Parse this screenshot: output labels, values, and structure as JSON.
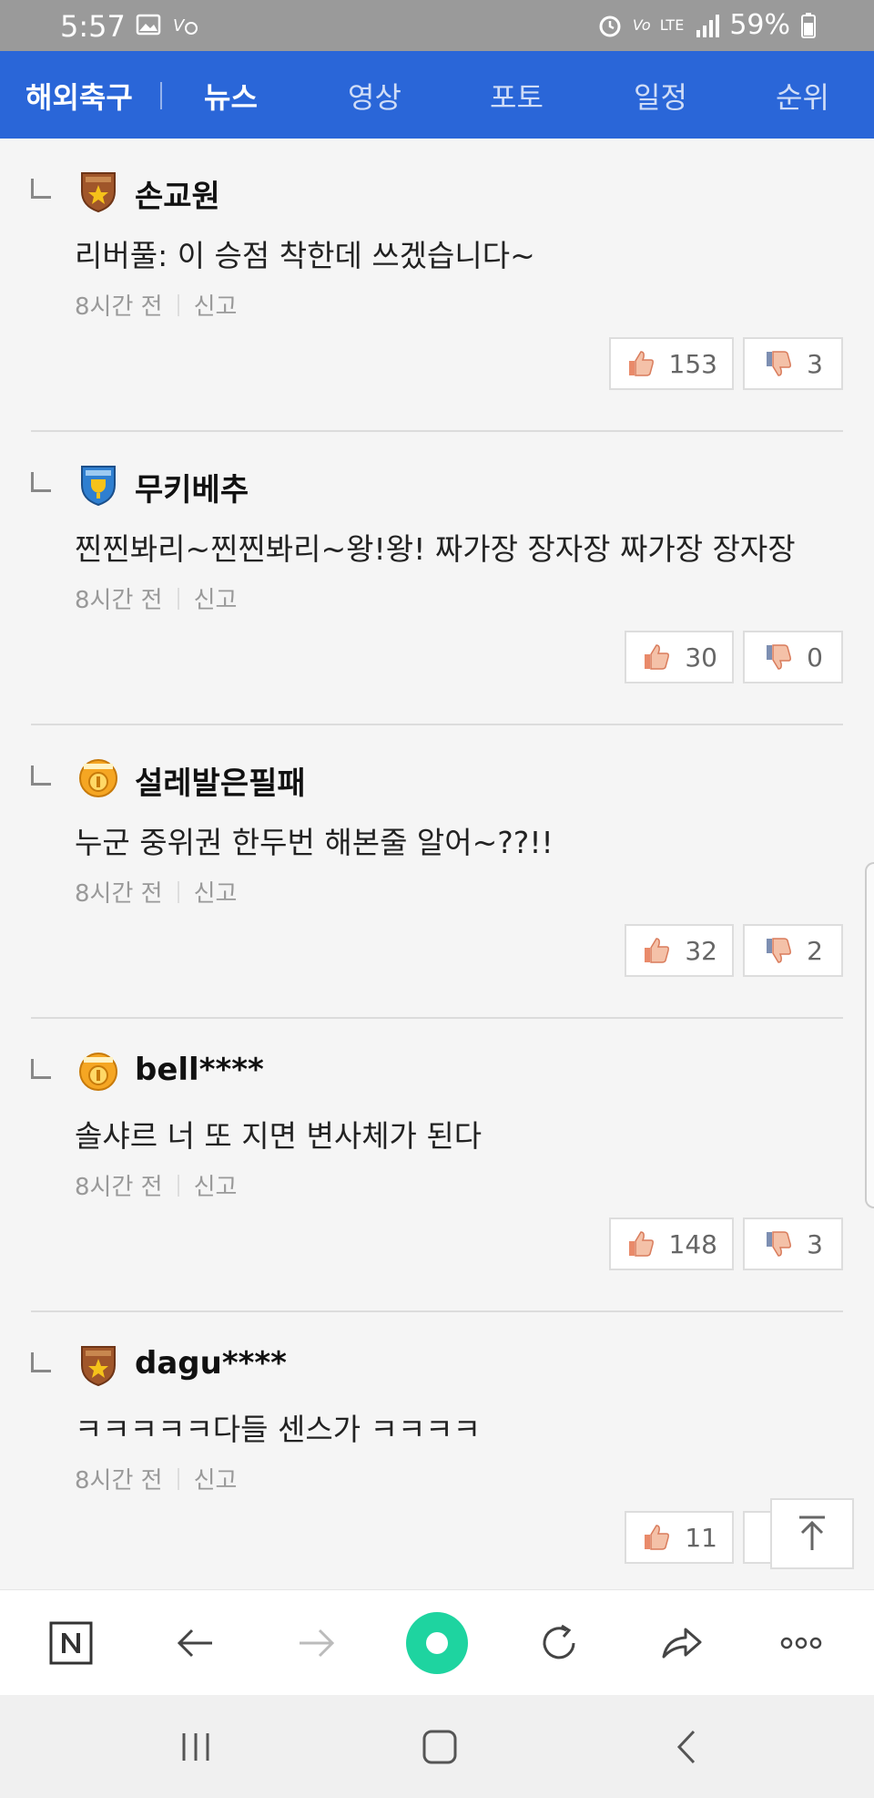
{
  "status_bar": {
    "time": "5:57",
    "battery": "59%",
    "network": "LTE"
  },
  "nav": {
    "section": "해외축구",
    "tabs": [
      {
        "label": "뉴스",
        "active": true
      },
      {
        "label": "영상",
        "active": false
      },
      {
        "label": "포토",
        "active": false
      },
      {
        "label": "일정",
        "active": false
      },
      {
        "label": "순위",
        "active": false
      }
    ]
  },
  "comments": [
    {
      "username": "손교원",
      "badge": "bronze-shield-star-icon",
      "text": "리버풀: 이 승점 착한데 쓰겠습니다~",
      "time": "8시간 전",
      "report": "신고",
      "likes": "153",
      "dislikes": "3"
    },
    {
      "username": "무키베추",
      "badge": "pro-blue-shield-icon",
      "text": "찐찐봐리~찐찐봐리~왕!왕! 짜가장 장자장 짜가장 장자장",
      "time": "8시간 전",
      "report": "신고",
      "likes": "30",
      "dislikes": "0"
    },
    {
      "username": "설레발은필패",
      "badge": "master-gold-badge-icon",
      "text": "누군 중위권 한두번 해본줄 알어~??!!",
      "time": "8시간 전",
      "report": "신고",
      "likes": "32",
      "dislikes": "2"
    },
    {
      "username": "bell****",
      "badge": "master-gold-badge-icon",
      "text": "솔샤르 너 또 지면 변사체가 된다",
      "time": "8시간 전",
      "report": "신고",
      "likes": "148",
      "dislikes": "3"
    },
    {
      "username": "dagu****",
      "badge": "bronze-shield-star-icon",
      "text": "ㅋㅋㅋㅋㅋ다들 센스가 ㅋㅋㅋㅋ",
      "time": "8시간 전",
      "report": "신고",
      "likes": "11",
      "dislikes": ""
    }
  ],
  "toolbar": {
    "items": [
      "naver-home-icon",
      "back-arrow-icon",
      "forward-arrow-icon",
      "green-dot-icon",
      "refresh-icon",
      "share-icon",
      "more-icon"
    ]
  },
  "colors": {
    "nav_bg": "#2a66d8",
    "status_bg": "#9a9a9a",
    "green_dot": "#1ed4a0"
  }
}
